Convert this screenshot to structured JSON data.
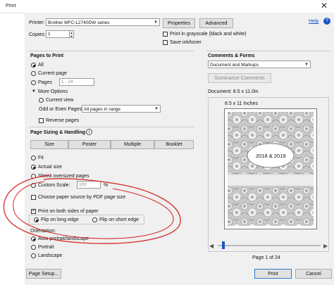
{
  "window": {
    "title": "Print",
    "close": "✕"
  },
  "printer": {
    "label": "Printer:",
    "value": "Brother MFC-L2740DW series",
    "properties": "Properties",
    "advanced": "Advanced",
    "help": "Help",
    "copies_label": "Copies:",
    "copies_value": "1",
    "grayscale": "Print in grayscale (black and white)",
    "grayscale_checked": false,
    "save_ink": "Save ink/toner",
    "save_ink_checked": false
  },
  "pages": {
    "title": "Pages to Print",
    "all": "All",
    "current": "Current page",
    "pages": "Pages",
    "range_placeholder": "1 - 24",
    "more_options": "More Options",
    "current_view": "Current view",
    "odd_even_label": "Odd or Even Pages:",
    "odd_even_value": "All pages in range",
    "reverse": "Reverse pages",
    "selected": "all"
  },
  "sizing": {
    "title": "Page Sizing & Handling",
    "tabs": [
      "Size",
      "Poster",
      "Multiple",
      "Booklet"
    ],
    "fit": "Fit",
    "actual": "Actual size",
    "shrink": "Shrink oversized pages",
    "custom": "Custom Scale:",
    "custom_value": "100",
    "percent": "%",
    "choose_source": "Choose paper source by PDF page size",
    "both_sides": "Print on both sides of paper",
    "both_sides_checked": true,
    "flip_long": "Flip on long edge",
    "flip_short": "Flip on short edge",
    "selected": "actual"
  },
  "orientation": {
    "title": "Orientation:",
    "auto": "Auto portrait/landscape",
    "portrait": "Portrait",
    "landscape": "Landscape",
    "selected": "auto"
  },
  "comments": {
    "title": "Comments & Forms",
    "value": "Document and Markups",
    "summarize": "Summarize Comments",
    "document_size": "Document: 8.5 x 11.0in"
  },
  "preview": {
    "size_label": "8.5 x 11 Inches",
    "label_text": "2018 & 2019",
    "page_indicator": "Page 1 of 24",
    "slider_fraction": 0.04
  },
  "footer": {
    "page_setup": "Page Setup...",
    "print": "Print",
    "cancel": "Cancel"
  },
  "colors": {
    "annotation": "#d42a2a",
    "accent": "#1a55c4",
    "primary_border": "#2b7cd3"
  }
}
